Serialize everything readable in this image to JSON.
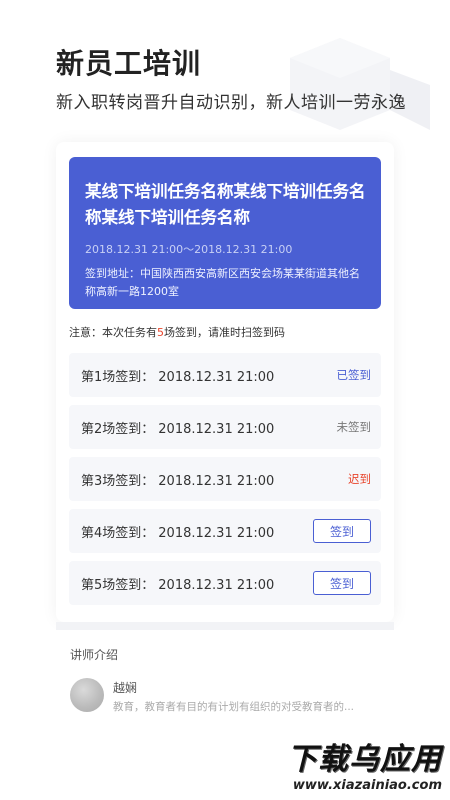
{
  "hero": {
    "title": "新员工培训",
    "subtitle": "新入职转岗晋升自动识别，新人培训一劳永逸"
  },
  "task": {
    "title": "某线下培训任务名称某线下培训任务名称某线下培训任务名称",
    "time": "2018.12.31  21:00～2018.12.31  21:00",
    "address": "签到地址：中国陕西西安高新区西安会场某某街道其他名称高新一路1200室"
  },
  "notice": {
    "prefix": "注意：本次任务有",
    "count": "5",
    "suffix": "场签到，请准时扫签到码"
  },
  "sessions": [
    {
      "label": "第1场签到：",
      "time": "2018.12.31  21:00",
      "status": "已签到"
    },
    {
      "label": "第2场签到：",
      "time": "2018.12.31  21:00",
      "status": "未签到"
    },
    {
      "label": "第3场签到：",
      "time": "2018.12.31  21:00",
      "status": "迟到"
    },
    {
      "label": "第4场签到：",
      "time": "2018.12.31  21:00",
      "button": "签到"
    },
    {
      "label": "第5场签到：",
      "time": "2018.12.31  21:00",
      "button": "签到"
    }
  ],
  "teacher": {
    "heading": "讲师介绍",
    "name": "越娴",
    "desc": "教育，教育者有目的有计划有组织的对受教育者的..."
  },
  "watermark": {
    "title": "下载乌应用",
    "url": "www.xiazainiao.com"
  },
  "colors": {
    "accent": "#4a5fd3",
    "late": "#e8452c",
    "notice_highlight": "#e8452c"
  }
}
